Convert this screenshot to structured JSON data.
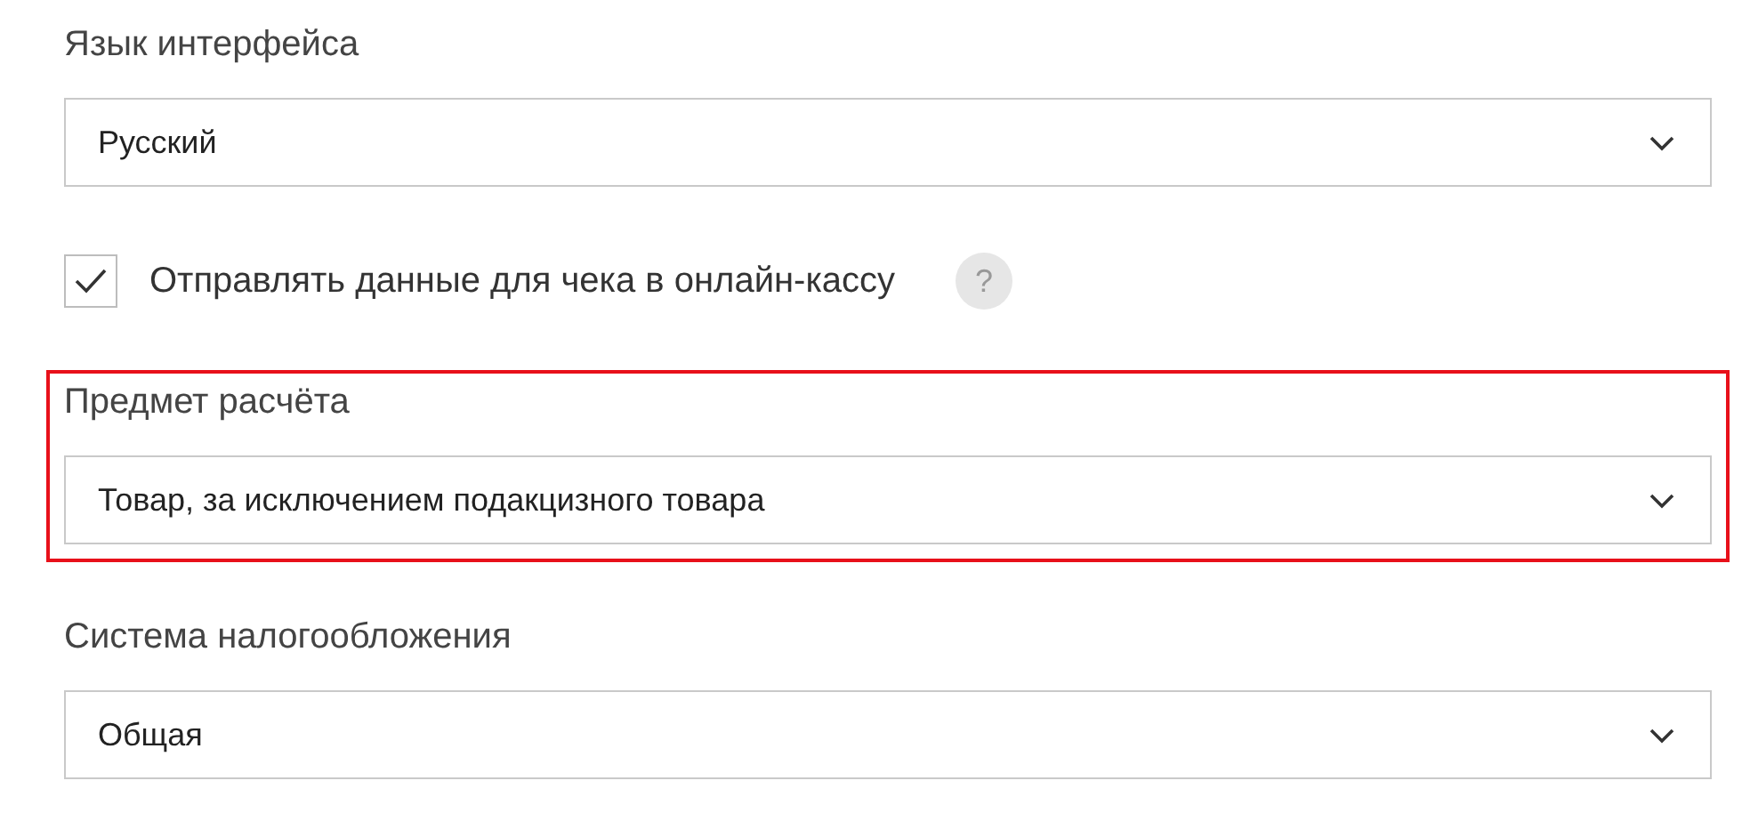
{
  "settings": [
    {
      "kind": "select",
      "label": "Язык интерфейса",
      "value": "Русский",
      "highlighted": false
    },
    {
      "kind": "checkbox",
      "label": "Отправлять данные для чека в онлайн-кассу",
      "checked": true,
      "help": "?"
    },
    {
      "kind": "select",
      "label": "Предмет расчёта",
      "value": "Товар, за исключением подакцизного товара",
      "highlighted": true
    },
    {
      "kind": "select",
      "label": "Система налогообложения",
      "value": "Общая",
      "highlighted": false
    }
  ]
}
